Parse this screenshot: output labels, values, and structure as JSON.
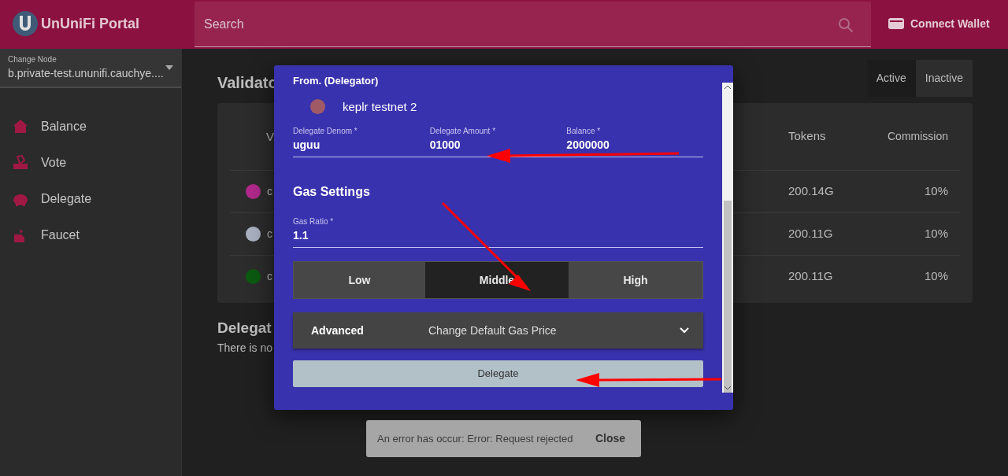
{
  "header": {
    "title": "UnUniFi Portal",
    "search": {
      "placeholder": "Search"
    },
    "wallet_button": "Connect Wallet"
  },
  "sidebar": {
    "node_label": "Change Node",
    "node_value": "b.private-test.ununifi.cauchye....",
    "items": [
      {
        "label": "Balance",
        "kind": "home"
      },
      {
        "label": "Vote",
        "kind": "vote"
      },
      {
        "label": "Delegate",
        "kind": "piggy"
      },
      {
        "label": "Faucet",
        "kind": "faucet"
      }
    ]
  },
  "validators": {
    "title": "Validato",
    "filters": [
      {
        "label": "Active",
        "selected": true
      },
      {
        "label": "Inactive",
        "selected": false
      }
    ],
    "columns": [
      "V",
      "Tokens",
      "Commission"
    ],
    "rows": [
      {
        "color": "#b0298a",
        "name": "c",
        "tokens": "200.14G",
        "commission": "10%"
      },
      {
        "color": "#a9b0c0",
        "name": "c",
        "tokens": "200.11G",
        "commission": "10%"
      },
      {
        "color": "#0b5a10",
        "name": "c",
        "tokens": "200.11G",
        "commission": "10%"
      }
    ]
  },
  "delegations": {
    "title": "Delegat",
    "message": "There is no"
  },
  "dialog": {
    "from_label": "From. (Delegator)",
    "account": {
      "name": "keplr testnet 2",
      "color": "#a05a66"
    },
    "fields": [
      {
        "label": "Delegate Denom *",
        "value": "uguu"
      },
      {
        "label": "Delegate Amount *",
        "value": "01000"
      },
      {
        "label": "Balance *",
        "value": "2000000"
      }
    ],
    "gas_title": "Gas Settings",
    "gas_ratio": {
      "label": "Gas Ratio *",
      "value": "1.1"
    },
    "gas_options": [
      {
        "label": "Low",
        "selected": false
      },
      {
        "label": "Middle",
        "selected": true
      },
      {
        "label": "High",
        "selected": false
      }
    ],
    "advanced": {
      "title": "Advanced",
      "subtitle": "Change Default Gas Price",
      "expanded": false
    },
    "submit": "Delegate"
  },
  "snackbar": {
    "message": "An error has occur: Error: Request rejected",
    "action": "Close"
  }
}
